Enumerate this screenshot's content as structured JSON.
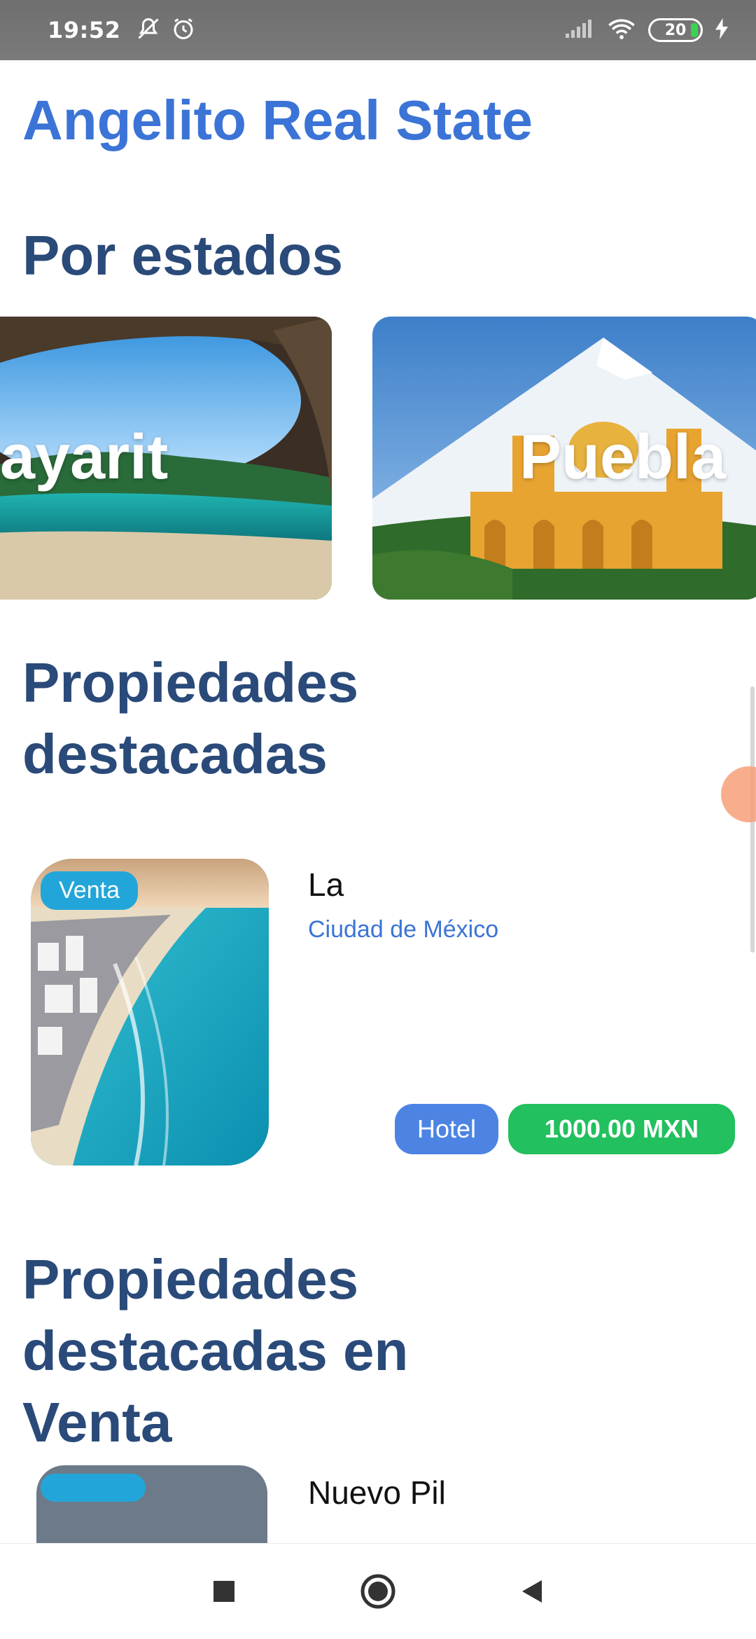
{
  "status_bar": {
    "time": "19:52",
    "battery": "20",
    "icons": [
      "mute-icon",
      "alarm-icon",
      "signal-icon",
      "wifi-icon",
      "battery-icon",
      "charging-icon"
    ]
  },
  "app": {
    "title": "Angelito Real State"
  },
  "sections": {
    "by_state_title": "Por estados",
    "featured_title_line1": "Propiedades",
    "featured_title_line2": "destacadas",
    "featured_sale_line1": "Propiedades",
    "featured_sale_line2": "destacadas en",
    "featured_sale_line3": "Venta"
  },
  "states": [
    {
      "label": "ayarit"
    },
    {
      "label": "Puebla"
    }
  ],
  "featured_property": {
    "badge": "Venta",
    "title": "La",
    "location": "Ciudad de México",
    "type": "Hotel",
    "price": "1000.00 MXN"
  },
  "next_property": {
    "title": "Nuevo Pil"
  },
  "colors": {
    "accent_blue": "#3b74d6",
    "section_title": "#2a4a79",
    "badge_venta": "#22a6d9",
    "price_green": "#22c05e",
    "type_blue": "#4d84e4"
  },
  "navigation": {
    "buttons": [
      "recents-icon",
      "home-icon",
      "back-icon"
    ]
  }
}
